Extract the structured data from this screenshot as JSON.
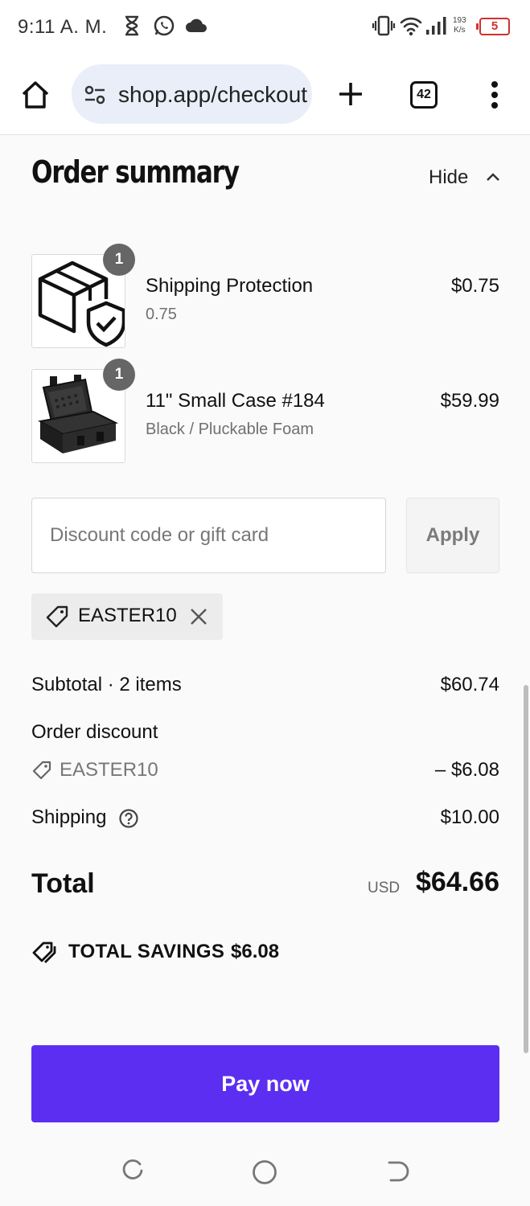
{
  "status_bar": {
    "time": "9:11 A. M.",
    "net_speed_value": "193",
    "net_speed_unit": "K/s",
    "battery": "5",
    "icons": [
      "hourglass-icon",
      "whatsapp-icon",
      "cloud-icon",
      "vibrate-icon",
      "wifi-icon",
      "signal-icon"
    ]
  },
  "browser": {
    "url": "shop.app/checkout",
    "tab_count": "42",
    "icons": [
      "home-icon",
      "site-settings-icon",
      "new-tab-icon",
      "tab-switcher-icon",
      "more-menu-icon"
    ]
  },
  "order_summary": {
    "title": "Order summary",
    "toggle_label": "Hide",
    "items": [
      {
        "quantity": "1",
        "name": "Shipping Protection",
        "variant": "0.75",
        "price": "$0.75",
        "thumbnail": "box-shield-icon"
      },
      {
        "quantity": "1",
        "name": "11\" Small Case #184",
        "variant": "Black / Pluckable Foam",
        "price": "$59.99",
        "thumbnail": "hard-case-image"
      }
    ],
    "discount": {
      "placeholder": "Discount code or gift card",
      "apply_label": "Apply",
      "applied_code": "EASTER10"
    },
    "totals": {
      "subtotal_label": "Subtotal · 2 items",
      "subtotal_value": "$60.74",
      "order_discount_label": "Order discount",
      "discount_code": "EASTER10",
      "discount_value": "– $6.08",
      "shipping_label": "Shipping",
      "shipping_value": "$10.00",
      "total_label": "Total",
      "currency": "USD",
      "total_value": "$64.66"
    },
    "savings": {
      "label": "TOTAL SAVINGS",
      "value": "$6.08"
    },
    "pay_label": "Pay now"
  },
  "colors": {
    "pay_button": "#5c2ef2",
    "battery_low": "#d32f2f",
    "url_bar": "#e9eef9"
  },
  "nav_bar": {
    "icons": [
      "recents-icon",
      "home-circle-icon",
      "back-icon"
    ]
  }
}
